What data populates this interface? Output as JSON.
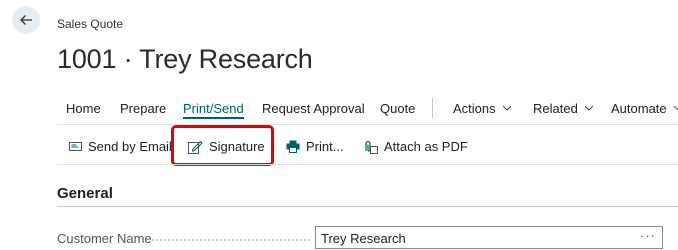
{
  "page": {
    "caption": "Sales Quote",
    "title": "1001 · Trey Research"
  },
  "menu": {
    "home": "Home",
    "prepare": "Prepare",
    "print_send": "Print/Send",
    "request_approval": "Request Approval",
    "quote": "Quote",
    "actions": "Actions",
    "related": "Related",
    "automate": "Automate"
  },
  "actions": {
    "send_by_email": "Send by Email",
    "signature": "Signature",
    "print": "Print...",
    "attach_as_pdf": "Attach as PDF"
  },
  "general": {
    "heading": "General",
    "customer_name_label": "Customer Name",
    "customer_name_value": "Trey Research",
    "more_icon": "···"
  },
  "colors": {
    "accent": "#00616e",
    "highlight": "#e60000"
  }
}
